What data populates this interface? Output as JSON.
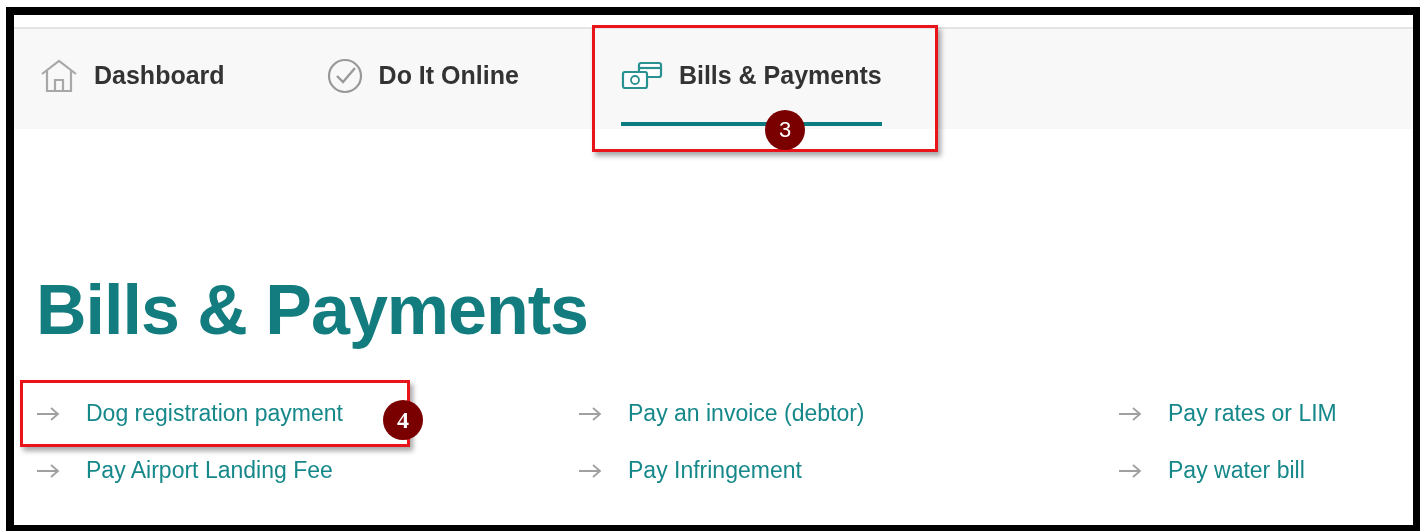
{
  "nav": {
    "tabs": [
      {
        "label": "Dashboard",
        "selected": false
      },
      {
        "label": "Do It Online",
        "selected": false
      },
      {
        "label": "Bills & Payments",
        "selected": true
      }
    ]
  },
  "heading": "Bills & Payments",
  "links": [
    {
      "label": "Dog registration payment"
    },
    {
      "label": "Pay an invoice (debtor)"
    },
    {
      "label": "Pay rates or LIM"
    },
    {
      "label": "Pay Airport Landing Fee"
    },
    {
      "label": "Pay Infringement"
    },
    {
      "label": "Pay water bill"
    }
  ],
  "annotations": [
    {
      "number": "3"
    },
    {
      "number": "4"
    }
  ]
}
